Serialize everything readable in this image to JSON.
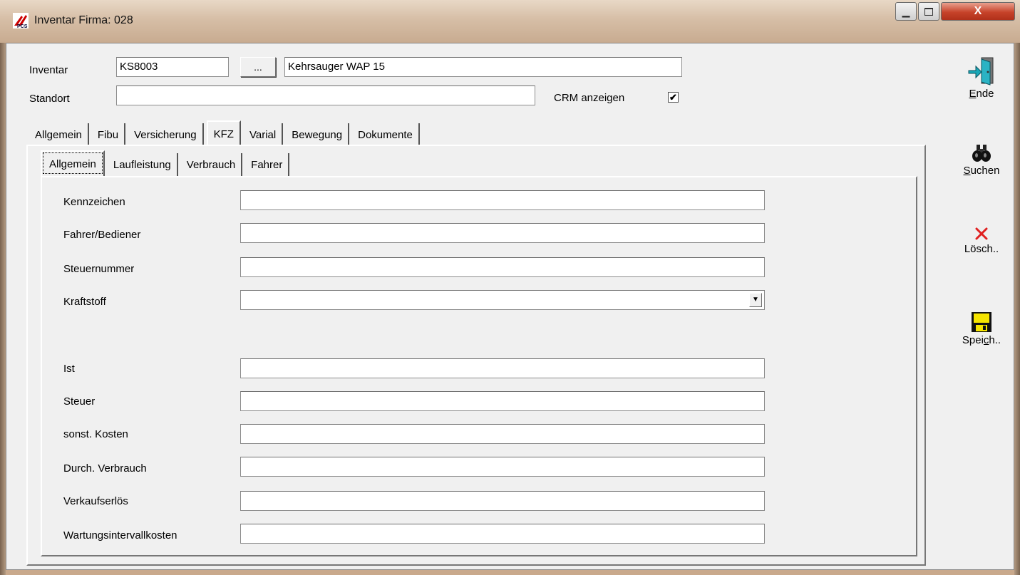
{
  "window": {
    "title": "Inventar Firma: 028",
    "controls": {
      "minimize": "▁",
      "maximize": "▫",
      "close": "X"
    },
    "icon": "pcs-app-icon"
  },
  "header": {
    "inventar_label": "Inventar",
    "inventar_code": "KS8003",
    "browse_button": "...",
    "inventar_name": "Kehrsauger WAP 15",
    "standort_label": "Standort",
    "standort_value": "",
    "crm_label": "CRM anzeigen",
    "crm_checked": "✔"
  },
  "main_tabs": [
    "Allgemein",
    "Fibu",
    "Versicherung",
    "KFZ",
    "Varial",
    "Bewegung",
    "Dokumente"
  ],
  "main_active_tab": "KFZ",
  "sub_tabs": [
    "Allgemein",
    "Laufleistung",
    "Verbrauch",
    "Fahrer"
  ],
  "sub_active_tab": "Allgemein",
  "form": {
    "kennzeichen_label": "Kennzeichen",
    "kennzeichen_value": "",
    "fahrer_label": "Fahrer/Bediener",
    "fahrer_value": "",
    "steuernummer_label": "Steuernummer",
    "steuernummer_value": "",
    "kraftstoff_label": "Kraftstoff",
    "kraftstoff_value": "",
    "ist_label": "Ist",
    "ist_value": "",
    "steuer_label": "Steuer",
    "steuer_value": "",
    "sonst_label": "sonst. Kosten",
    "sonst_value": "",
    "durch_label": "Durch. Verbrauch",
    "durch_value": "",
    "verkauf_label": "Verkaufserlös",
    "verkauf_value": "",
    "wartung_label": "Wartungsintervallkosten",
    "wartung_value": ""
  },
  "sidebar": {
    "ende": {
      "label_u": "E",
      "label_rest": "nde",
      "icon": "exit-door-icon"
    },
    "suchen": {
      "label_u": "S",
      "label_rest": "uchen",
      "icon": "binoculars-icon"
    },
    "loeschen": {
      "label": "Lösch..",
      "icon": "delete-x-icon"
    },
    "speichern": {
      "label_pre": "Spei",
      "label_u": "c",
      "label_post": "h..",
      "icon": "floppy-disk-icon"
    }
  },
  "colors": {
    "delete_red": "#e02020",
    "floppy_yellow": "#f5e400",
    "exit_teal": "#1aa7b7"
  }
}
